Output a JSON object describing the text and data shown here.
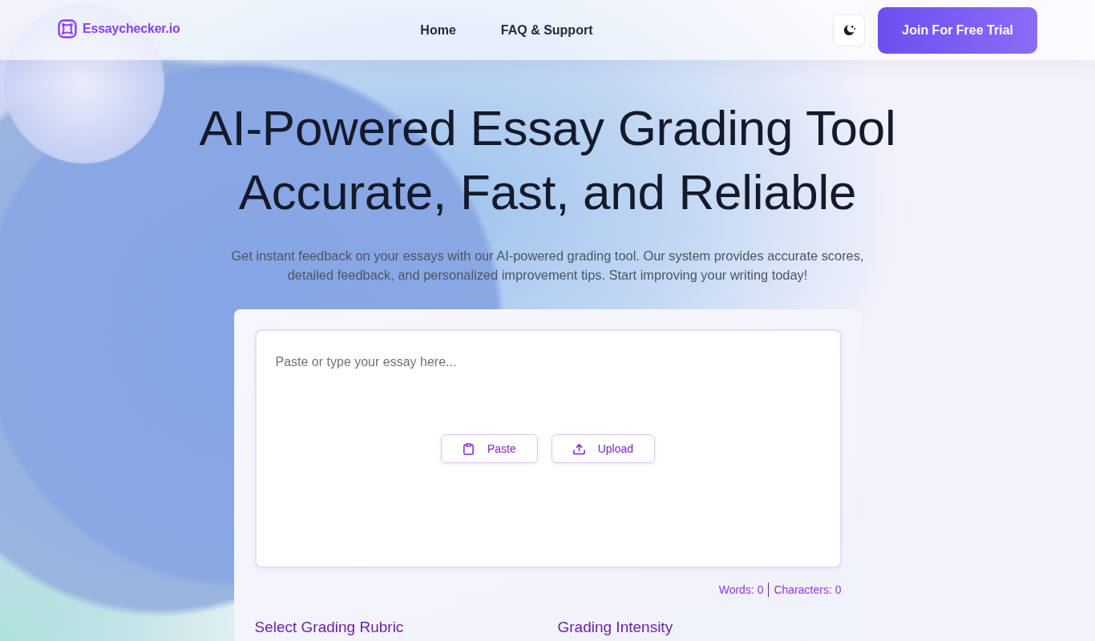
{
  "header": {
    "logo": "Essaychecker.io",
    "nav": [
      {
        "label": "Home"
      },
      {
        "label": "FAQ & Support"
      }
    ],
    "cta": "Join For Free Trial"
  },
  "hero": {
    "title_lines": [
      "AI-Powered Essay Grading Tool",
      "Accurate, Fast, and Reliable"
    ],
    "subtitle": "Get instant feedback on your essays with our AI-powered grading tool. Our system provides accurate scores, detailed feedback, and personalized improvement tips. Start improving your writing today!"
  },
  "editor": {
    "placeholder": "Paste or type your essay here...",
    "buttons": [
      {
        "kind": "paste",
        "label": "Paste"
      },
      {
        "kind": "upload",
        "label": "Upload"
      }
    ],
    "word_count": "Words: 0",
    "char_count": "Characters: 0"
  },
  "settings": {
    "sections": [
      {
        "title": "Select Grading Rubric"
      },
      {
        "title": "Grading Intensity"
      }
    ]
  }
}
